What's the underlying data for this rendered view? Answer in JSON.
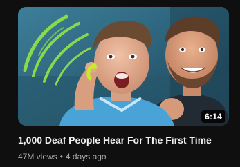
{
  "video": {
    "title": "1,000 Deaf People Hear For The First Time",
    "duration": "6:14",
    "views": "47M views",
    "separator": "•",
    "age": "4 days ago"
  },
  "thumbnail": {
    "accent_green": "#8ee04a",
    "background_blue": "#2f6a83",
    "shirt_blue": "#4aa3d6"
  }
}
